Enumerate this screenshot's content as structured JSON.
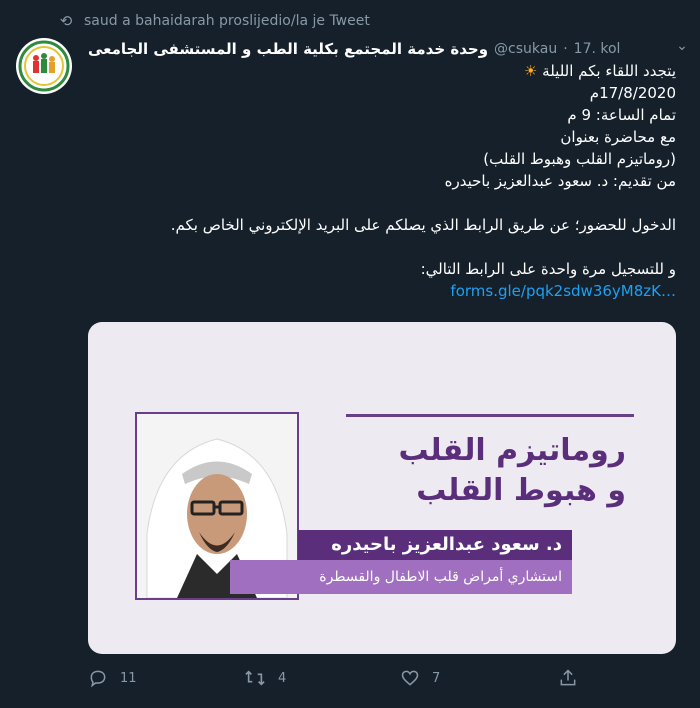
{
  "retweet": {
    "icon": "retweet-icon",
    "text": "saud a bahaidarah proslijedio/la je Tweet"
  },
  "tweet": {
    "author_name": "وحدة خدمة المجتمع بكلية الطب و المستشفى الجامعى",
    "handle": "@csukau",
    "separator": "·",
    "date": "17. kol",
    "lines": [
      "يتجدد اللقاء بكم الليلة",
      "17/8/2020م",
      "تمام الساعة: 9 م",
      "مع محاضرة بعنوان",
      "(روماتيزم القلب وهبوط القلب)",
      "من تقديم: د. سعود عبدالعزيز باحيدره",
      "",
      "الدخول للحضور؛ عن طريق الرابط الذي يصلكم على البريد الإلكتروني الخاص بكم.",
      "",
      "و للتسجيل مرة واحدة على الرابط التالي:"
    ],
    "sun_emoji": "☀",
    "link": "forms.gle/pqk2sdw36yM8zK…"
  },
  "media": {
    "title_line1": "روماتيزم القلب",
    "title_line2": "و هبوط القلب",
    "speaker": "د. سعود عبدالعزيز باحيدره",
    "speaker_title": "استشاري أمراض قلب الاطفال والقسطرة",
    "colors": {
      "purple_dark": "#5a2e7a",
      "purple_light": "#a06fc0",
      "background": "#eeeaf1"
    }
  },
  "actions": {
    "reply_count": "11",
    "retweet_count": "4",
    "like_count": "7"
  },
  "theme": {
    "background": "#15202b",
    "muted": "#8899a6",
    "link": "#1da1f2"
  }
}
